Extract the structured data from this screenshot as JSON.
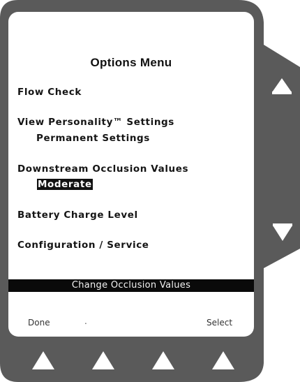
{
  "screen": {
    "title": "Options Menu",
    "menu_items": [
      {
        "label": "Flow Check"
      },
      {
        "label": "View Personality™ Settings",
        "sub": "Permanent Settings"
      },
      {
        "label": "Downstream Occlusion Values",
        "sub": "Moderate",
        "sub_selected": true
      },
      {
        "label": "Battery Charge Level"
      },
      {
        "label": "Configuration / Service"
      }
    ],
    "status_bar": "Change Occlusion Values",
    "softkeys": {
      "left": "Done",
      "middle": ".",
      "right": "Select"
    }
  },
  "device": {
    "bezel_color": "#5a5a5a",
    "screen_color": "#ffffff",
    "button_color": "#ffffff",
    "icons": [
      "scroll-up-arrow-icon",
      "scroll-down-arrow-icon",
      "softkey-triangle-icon"
    ]
  }
}
